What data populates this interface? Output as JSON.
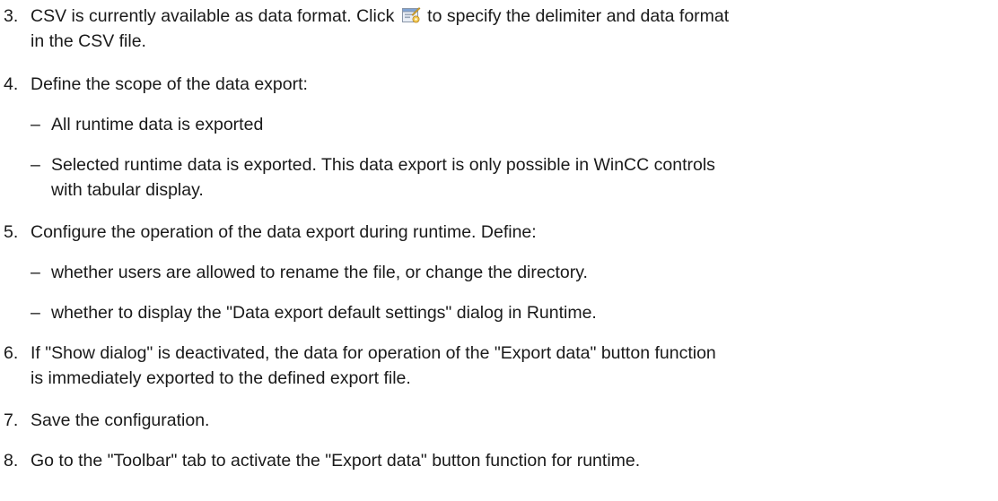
{
  "steps": [
    {
      "number": "3.",
      "line1_before_icon": "CSV is currently available as data format. Click",
      "icon": "settings-dialog-icon",
      "line1_after_icon": "to specify the delimiter and data format",
      "line2": "in the CSV file."
    },
    {
      "number": "4.",
      "line1": "Define the scope of the data export:",
      "subitems": [
        {
          "dash": "–",
          "line1": "All runtime data is exported"
        },
        {
          "dash": "–",
          "line1": "Selected runtime data is exported. This data export is only possible in WinCC controls",
          "line2": "with tabular display."
        }
      ]
    },
    {
      "number": "5.",
      "line1": "Configure the operation of the data export during runtime. Define:",
      "subitems": [
        {
          "dash": "–",
          "line1": "whether users are allowed to rename the file, or change the directory."
        },
        {
          "dash": "–",
          "line1": "whether to display the \"Data export default settings\" dialog in Runtime."
        }
      ]
    },
    {
      "number": "6.",
      "line1": "If \"Show dialog\" is deactivated, the data for operation of the \"Export data\" button function",
      "line2": "is immediately exported to the defined export file."
    },
    {
      "number": "7.",
      "line1": "Save the configuration."
    },
    {
      "number": "8.",
      "line1": "Go to the \"Toolbar\" tab to activate the \"Export data\" button function for runtime."
    }
  ]
}
